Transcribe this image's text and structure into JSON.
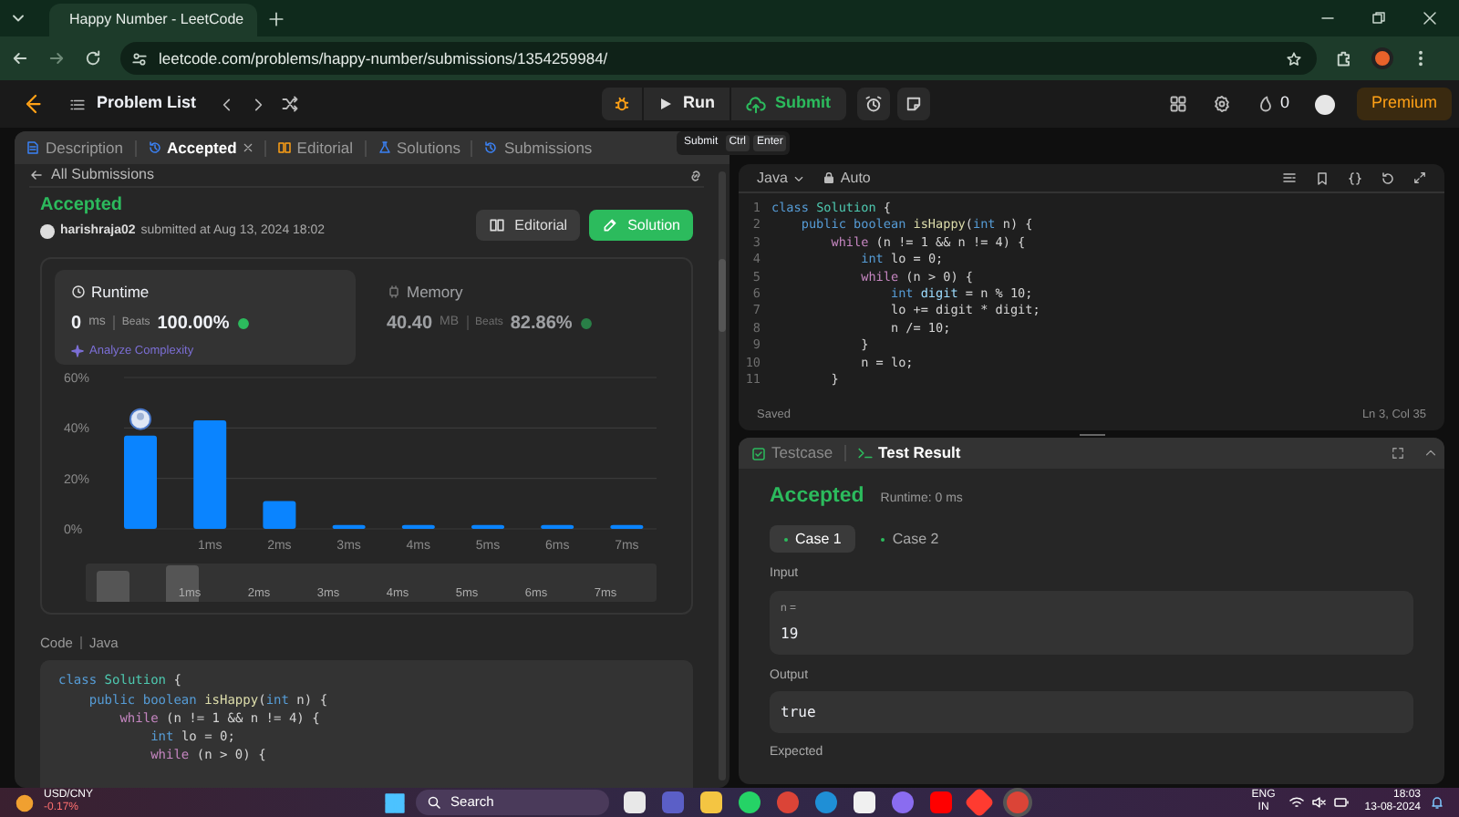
{
  "browser": {
    "tab_title": "Happy Number - LeetCode",
    "url": "leetcode.com/problems/happy-number/submissions/1354259984/"
  },
  "nav": {
    "problem_list": "Problem List",
    "run": "Run",
    "submit": "Submit",
    "streak": "0",
    "premium": "Premium"
  },
  "panel_tabs": [
    {
      "label": "Description",
      "selected": false
    },
    {
      "label": "Accepted",
      "selected": true
    },
    {
      "label": "Editorial",
      "selected": false
    },
    {
      "label": "Solutions",
      "selected": false
    },
    {
      "label": "Submissions",
      "selected": false
    }
  ],
  "shortcut_hint": [
    "Submit",
    "Ctrl",
    "Enter"
  ],
  "submission": {
    "back": "All Submissions",
    "status": "Accepted",
    "user": "harishraja02",
    "submitted": "submitted at Aug 13, 2024 18:02",
    "editorial_button": "Editorial",
    "solution_button": "Solution",
    "stats": [
      {
        "label": "Runtime",
        "value": "0",
        "unit": "ms",
        "beats_label": "Beats",
        "beats": "100.00%",
        "selected": true
      },
      {
        "label": "Memory",
        "value": "40.40",
        "unit": "MB",
        "beats_label": "Beats",
        "beats": "82.86%",
        "selected": false
      }
    ],
    "analyze": "Analyze Complexity",
    "chart_data": {
      "type": "bar",
      "categories": [
        null,
        "1ms",
        "2ms",
        "3ms",
        "4ms",
        "5ms",
        "6ms",
        "7ms"
      ],
      "values": [
        37,
        43,
        11,
        1.5,
        1.5,
        1.5,
        1.5,
        1.5
      ],
      "ylim": [
        0,
        60
      ],
      "yticks": [
        {
          "value": 0,
          "label": "0%"
        },
        {
          "value": 20,
          "label": "20%"
        },
        {
          "value": 40,
          "label": "40%"
        },
        {
          "value": 60,
          "label": "60%"
        }
      ]
    },
    "range_labels": [
      "1ms",
      "2ms",
      "3ms",
      "4ms",
      "5ms",
      "6ms",
      "7ms"
    ],
    "code_label": "Code",
    "code_language": "Java",
    "code": [
      [
        {
          "text": "class ",
          "kind": "kw"
        },
        {
          "text": "Solution",
          "kind": "type"
        },
        {
          "text": " {",
          "kind": "txt"
        }
      ],
      [
        {
          "text": "    public boolean ",
          "kind": "kw"
        },
        {
          "text": "isHappy",
          "kind": "fn"
        },
        {
          "text": "(",
          "kind": "txt"
        },
        {
          "text": "int ",
          "kind": "kw"
        },
        {
          "text": "n) {",
          "kind": "txt"
        }
      ],
      [
        {
          "text": "        while ",
          "kind": "ctl"
        },
        {
          "text": "(n != 1 && n != 4) {",
          "kind": "txt"
        }
      ],
      [
        {
          "text": "            int ",
          "kind": "kw"
        },
        {
          "text": "lo = 0;",
          "kind": "txt"
        }
      ],
      [
        {
          "text": "            while ",
          "kind": "ctl"
        },
        {
          "text": "(n > 0) {",
          "kind": "txt"
        }
      ]
    ]
  },
  "editor": {
    "language": "Java",
    "mode": "Auto",
    "status": "Saved",
    "cursor": "Ln 3, Col 35",
    "lines": [
      {
        "n": "1",
        "tokens": [
          {
            "text": "class ",
            "kind": "kw"
          },
          {
            "text": "Solution",
            "kind": "type"
          },
          {
            "text": " {",
            "kind": "txt"
          }
        ]
      },
      {
        "n": "2",
        "tokens": [
          {
            "text": "    public boolean ",
            "kind": "kw"
          },
          {
            "text": "isHappy",
            "kind": "fn"
          },
          {
            "text": "(",
            "kind": "txt"
          },
          {
            "text": "int ",
            "kind": "kw"
          },
          {
            "text": "n) {",
            "kind": "txt"
          }
        ]
      },
      {
        "n": "3",
        "tokens": [
          {
            "text": "        while ",
            "kind": "ctl"
          },
          {
            "text": "(n != 1 && n != 4) {",
            "kind": "txt"
          }
        ]
      },
      {
        "n": "4",
        "tokens": [
          {
            "text": "            int ",
            "kind": "kw"
          },
          {
            "text": "lo = 0;",
            "kind": "txt"
          }
        ]
      },
      {
        "n": "5",
        "tokens": [
          {
            "text": "            while ",
            "kind": "ctl"
          },
          {
            "text": "(n > 0) {",
            "kind": "txt"
          }
        ]
      },
      {
        "n": "6",
        "tokens": [
          {
            "text": "                int ",
            "kind": "kw"
          },
          {
            "text": "digit",
            "kind": "var"
          },
          {
            "text": " = n % 10;",
            "kind": "txt"
          }
        ]
      },
      {
        "n": "7",
        "tokens": [
          {
            "text": "                lo += digit * digit;",
            "kind": "txt"
          }
        ]
      },
      {
        "n": "8",
        "tokens": [
          {
            "text": "                n /= 10;",
            "kind": "txt"
          }
        ]
      },
      {
        "n": "9",
        "tokens": [
          {
            "text": "            }",
            "kind": "txt"
          }
        ]
      },
      {
        "n": "10",
        "tokens": [
          {
            "text": "            n = lo;",
            "kind": "txt"
          }
        ]
      },
      {
        "n": "11",
        "tokens": [
          {
            "text": "        }",
            "kind": "txt"
          }
        ]
      }
    ]
  },
  "result_tabs": [
    {
      "label": "Testcase",
      "selected": false
    },
    {
      "label": "Test Result",
      "selected": true
    }
  ],
  "result": {
    "status": "Accepted",
    "runtime": "Runtime: 0 ms",
    "cases": [
      {
        "label": "Case 1",
        "selected": true
      },
      {
        "label": "Case 2",
        "selected": false
      }
    ],
    "input_label": "Input",
    "input_var": "n =",
    "input_value": "19",
    "output_label": "Output",
    "output_value": "true",
    "expected_label": "Expected"
  },
  "taskbar": {
    "ticker": "USD/CNY",
    "change": "-0.17%",
    "search": "Search",
    "lang": "ENG",
    "region": "IN",
    "time": "18:03",
    "date": "13-08-2024"
  }
}
